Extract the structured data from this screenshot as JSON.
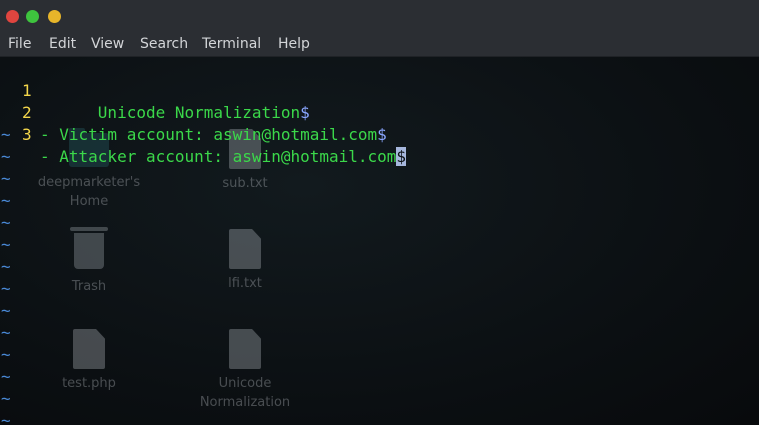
{
  "window": {
    "buttons": {
      "close": "close",
      "maximize": "maximize",
      "minimize": "minimize"
    }
  },
  "menu": [
    "File",
    "Edit",
    "View",
    "Search",
    "Terminal",
    "Help"
  ],
  "editor": {
    "lines": [
      {
        "num": "1",
        "text": "      Unicode Normalization",
        "eol": "$"
      },
      {
        "num": "2",
        "text": "- Victim account: aswin@hotmail.com",
        "eol": "$"
      },
      {
        "num": "3",
        "text": "- Attacker account: aswin@hotmail.com",
        "eol": "$"
      }
    ],
    "empty_line_marker": "~",
    "colors": {
      "line_number": "#f4d74b",
      "text": "#3bd84a",
      "eol": "#8aa6ff",
      "tilde": "#4a8ad8"
    }
  },
  "desktop": {
    "icons": [
      {
        "label1": "deepmarketer's",
        "label2": "Home",
        "icon": "home-folder-icon"
      },
      {
        "label1": "sub.txt",
        "label2": "",
        "icon": "text-file-icon"
      },
      {
        "label1": "Trash",
        "label2": "",
        "icon": "trash-icon"
      },
      {
        "label1": "lfi.txt",
        "label2": "",
        "icon": "text-file-icon"
      },
      {
        "label1": "test.php",
        "label2": "",
        "icon": "file-icon"
      },
      {
        "label1": "Unicode",
        "label2": "Normalization",
        "icon": "file-icon"
      }
    ]
  }
}
